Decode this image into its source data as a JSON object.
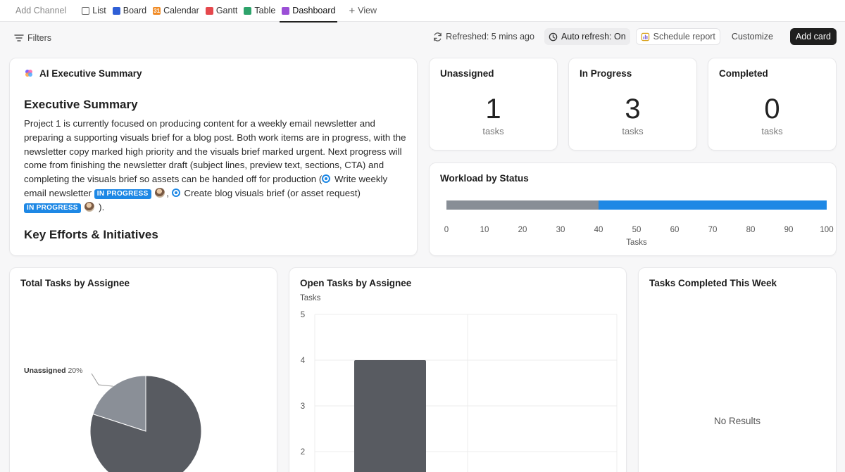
{
  "tabs": {
    "add_channel": "Add Channel",
    "list": "List",
    "board": "Board",
    "calendar": "Calendar",
    "gantt": "Gantt",
    "table": "Table",
    "dashboard": "Dashboard",
    "view": "View",
    "active": "Dashboard"
  },
  "toolbar": {
    "filters": "Filters",
    "refreshed": "Refreshed: 5 mins ago",
    "auto_refresh": "Auto refresh: On",
    "schedule_report": "Schedule report",
    "customize": "Customize",
    "add_card": "Add card"
  },
  "ai_summary": {
    "title": "AI Executive Summary",
    "heading": "Executive Summary",
    "paragraph_intro": "Project 1 is currently focused on producing content for a weekly email newsletter and preparing a supporting visuals brief for a blog post. Both work items are in progress, with the newsletter copy marked high priority and the visuals brief marked urgent. Next progress will come from finishing the newsletter draft (subject lines, preview text, sections, CTA) and completing the visuals brief so assets can be handed off for production (",
    "task1": "Write weekly email newsletter",
    "task1_status": "IN PROGRESS",
    "separator": ",",
    "task2": "Create blog visuals brief (or asset request)",
    "task2_status": "IN PROGRESS",
    "paragraph_end": ").",
    "subheading": "Key Efforts & Initiatives"
  },
  "stats": {
    "unassigned": {
      "label": "Unassigned",
      "value": "1",
      "unit": "tasks"
    },
    "in_progress": {
      "label": "In Progress",
      "value": "3",
      "unit": "tasks"
    },
    "completed": {
      "label": "Completed",
      "value": "0",
      "unit": "tasks"
    }
  },
  "colors": {
    "status_gray": "#888e96",
    "status_blue": "#1e88e5",
    "pie_dark": "#585b61",
    "pie_light": "#8a8f97",
    "bar_dark": "#585b61"
  },
  "chart_data": [
    {
      "type": "bar",
      "orientation": "horizontal",
      "stacked": true,
      "title": "Workload by Status",
      "xlabel": "Tasks",
      "xlim": [
        0,
        100
      ],
      "xticks": [
        0,
        10,
        20,
        30,
        40,
        50,
        60,
        70,
        80,
        90,
        100
      ],
      "segments": [
        {
          "value_start": 0,
          "value_end": 40,
          "color": "#888e96"
        },
        {
          "value_start": 40,
          "value_end": 100,
          "color": "#1e88e5"
        }
      ]
    },
    {
      "type": "pie",
      "title": "Total Tasks by Assignee",
      "slices": [
        {
          "label": "Unassigned",
          "percent": 20,
          "display": "20%",
          "color": "#8a8f97"
        },
        {
          "label": "",
          "percent": 80,
          "display": "",
          "color": "#585b61"
        }
      ]
    },
    {
      "type": "bar",
      "title": "Open Tasks by Assignee",
      "ylabel": "Tasks",
      "ylim": [
        1,
        5
      ],
      "yticks": [
        5,
        4,
        3,
        2
      ],
      "values": [
        4
      ],
      "categories": [
        ""
      ],
      "color": "#585b61"
    },
    {
      "type": "table",
      "title": "Tasks Completed This Week",
      "empty_message": "No Results"
    }
  ]
}
